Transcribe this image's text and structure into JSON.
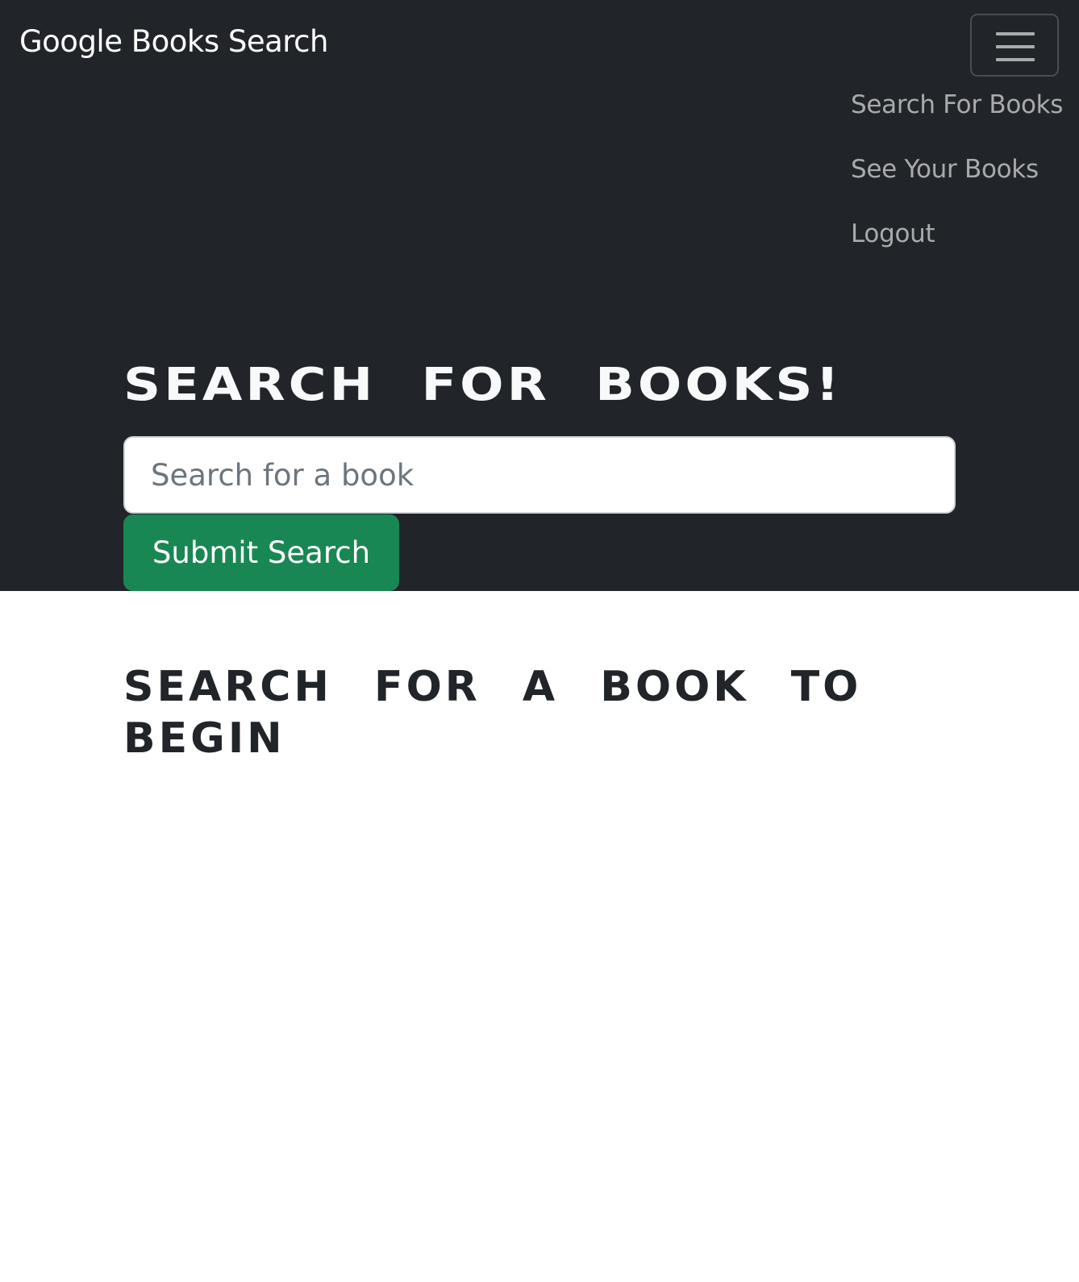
{
  "navbar": {
    "brand": "Google Books Search",
    "toggler_icon": "hamburger-menu-icon",
    "links": [
      {
        "label": "Search For Books"
      },
      {
        "label": "See Your Books"
      },
      {
        "label": "Logout"
      }
    ]
  },
  "hero": {
    "title": "SEARCH FOR BOOKS!",
    "search_placeholder": "Search for a book",
    "search_value": "",
    "submit_label": "Submit Search"
  },
  "results": {
    "heading": "SEARCH FOR A BOOK TO BEGIN"
  },
  "colors": {
    "navbar_bg": "#212529",
    "submit_bg": "#198754",
    "link_color": "#a9aaac",
    "page_bg": "#ffffff"
  }
}
